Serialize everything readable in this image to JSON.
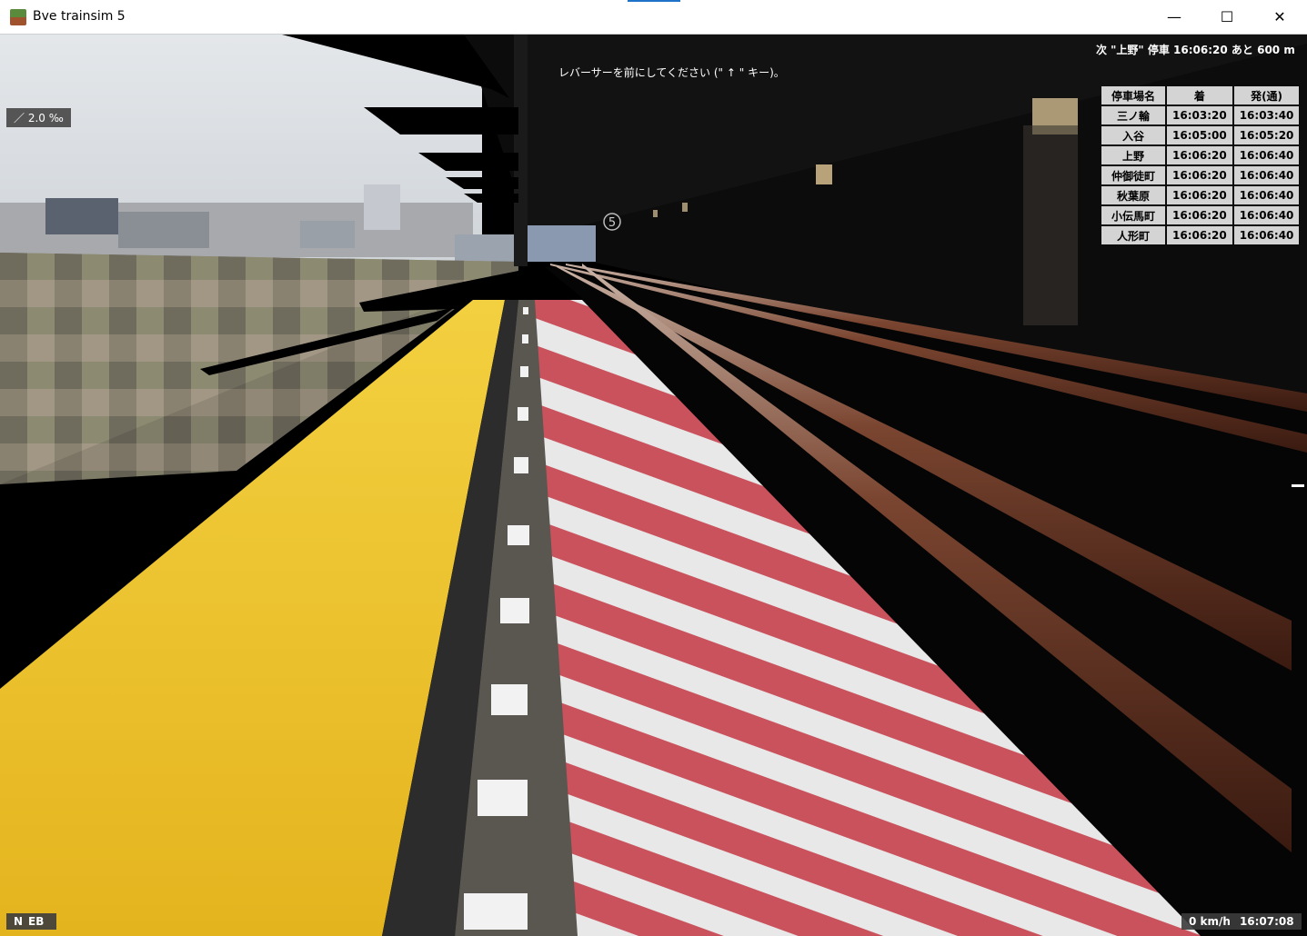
{
  "window": {
    "title": "Bve trainsim 5",
    "minimize": "—",
    "maximize": "☐",
    "close": "✕"
  },
  "hud": {
    "gradient": "／ 2.0 ‰",
    "message": "レバーサーを前にしてください (\" ↑ \" キー)。",
    "next_stop": "次 \"上野\" 停車 16:06:20 あと 600 m",
    "timetable": {
      "headers": [
        "停車場名",
        "着",
        "発(通)"
      ],
      "rows": [
        [
          "三ノ輪",
          "16:03:20",
          "16:03:40"
        ],
        [
          "入谷",
          "16:05:00",
          "16:05:20"
        ],
        [
          "上野",
          "16:06:20",
          "16:06:40"
        ],
        [
          "仲御徒町",
          "16:06:20",
          "16:06:40"
        ],
        [
          "秋葉原",
          "16:06:20",
          "16:06:40"
        ],
        [
          "小伝馬町",
          "16:06:20",
          "16:06:40"
        ],
        [
          "人形町",
          "16:06:20",
          "16:06:40"
        ]
      ]
    },
    "reverser": "N",
    "brake": "EB",
    "speed": "0 km/h",
    "clock": "16:07:08",
    "station_marker": "5"
  },
  "colors": {
    "tactile_yellow": "#e8b820",
    "platform_red": "#c8505a",
    "platform_white": "#e6e6e6",
    "sky": "#dde1e6",
    "rail": "#6b3a26"
  }
}
